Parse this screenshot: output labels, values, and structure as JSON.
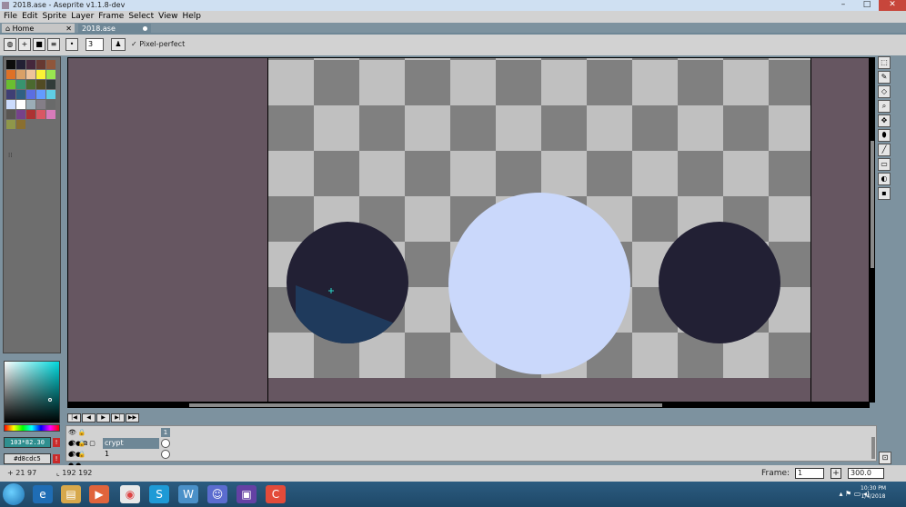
{
  "window": {
    "title": "2018.ase - Aseprite v1.1.8-dev"
  },
  "menu": [
    "File",
    "Edit",
    "Sprite",
    "Layer",
    "Frame",
    "Select",
    "View",
    "Help"
  ],
  "tabs": {
    "home": "Home",
    "file": "2018.ase"
  },
  "toolbar": {
    "brush_size": "3",
    "pixel_perfect_label": "Pixel-perfect"
  },
  "palette": {
    "colors": [
      "#0d0d0d",
      "#222034",
      "#45283c",
      "#663931",
      "#8f563b",
      "#df7126",
      "#d9a066",
      "#eec39a",
      "#fbf236",
      "#99e550",
      "#6abe30",
      "#37946e",
      "#4b692f",
      "#524b24",
      "#323c39",
      "#3f3f74",
      "#306082",
      "#5b6ee1",
      "#639bff",
      "#5fcde4",
      "#cbdbfc",
      "#ffffff",
      "#9badb7",
      "#847e87",
      "#696a6a",
      "#595652",
      "#76428a",
      "#ac3232",
      "#d95763",
      "#d77bba",
      "#8f974a",
      "#8a6f30"
    ]
  },
  "colors": {
    "foreground": "103*82.30",
    "background": "#d8cdc5"
  },
  "canvas": {
    "dark_circle": "#222034",
    "light_circle": "#cad8fb",
    "accent": "#1f3a5c"
  },
  "timeline": {
    "frame_buttons": [
      "first-frame-icon",
      "prev-frame-icon",
      "play-icon",
      "next-frame-icon",
      "last-frame-icon"
    ],
    "frame_header": "1",
    "layers": [
      {
        "name": "crypt"
      },
      {
        "name": "1"
      }
    ]
  },
  "status": {
    "cursor": "21 97",
    "size": "192 192",
    "frame_label": "Frame:",
    "frame_value": "1",
    "zoom": "300.0"
  },
  "taskbar": {
    "time": "10:30 PM",
    "date": "1/4/2018"
  }
}
